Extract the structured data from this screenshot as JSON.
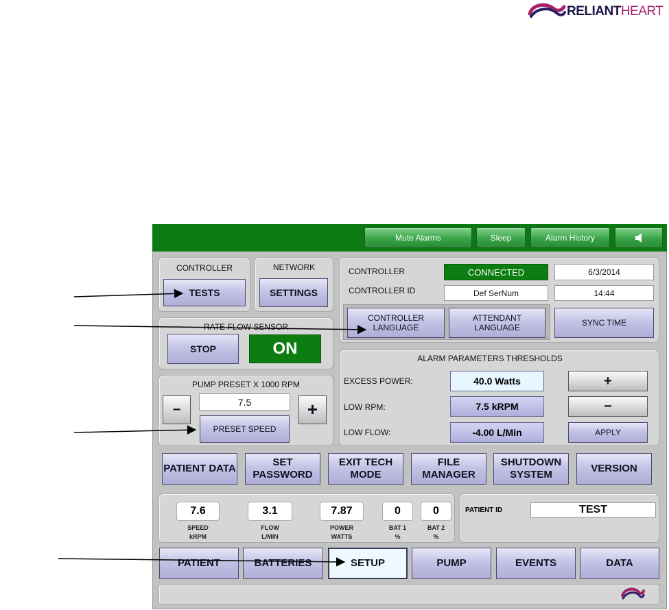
{
  "logo": {
    "part1": "RELIANT",
    "part2": "HEART"
  },
  "topbar": {
    "mute_alarms": "Mute Alarms",
    "sleep": "Sleep",
    "alarm_history": "Alarm History",
    "speaker_icon": "speaker-icon"
  },
  "controller_tests": {
    "title": "CONTROLLER",
    "button": "TESTS"
  },
  "network_settings": {
    "title": "NETWORK",
    "button": "SETTINGS"
  },
  "status": {
    "controller_label": "CONTROLLER",
    "controller_status": "CONNECTED",
    "date": "6/3/2014",
    "controller_id_label": "CONTROLLER ID",
    "controller_id": "Def SerNum",
    "time": "14:44",
    "controller_language": "CONTROLLER LANGUAGE",
    "attendant_language": "ATTENDANT LANGUAGE",
    "sync_time": "SYNC TIME",
    "status_color": "#0b7d11"
  },
  "rate_flow_sensor": {
    "title": "RATE FLOW SENSOR",
    "stop": "STOP",
    "state": "ON"
  },
  "pump_preset": {
    "title": "PUMP PRESET X 1000 RPM",
    "value": "7.5",
    "minus": "−",
    "plus": "+",
    "preset_speed": "PRESET SPEED"
  },
  "alarm_thresholds": {
    "title": "ALARM PARAMETERS THRESHOLDS",
    "excess_power_label": "EXCESS POWER:",
    "excess_power_value": "40.0 Watts",
    "low_rpm_label": "LOW RPM:",
    "low_rpm_value": "7.5 kRPM",
    "low_flow_label": "LOW FLOW:",
    "low_flow_value": "-4.00 L/Min",
    "plus": "+",
    "minus": "−",
    "apply": "APPLY"
  },
  "actions": [
    {
      "label": "PATIENT DATA"
    },
    {
      "label": "SET PASSWORD"
    },
    {
      "label": "EXIT TECH MODE"
    },
    {
      "label": "FILE MANAGER"
    },
    {
      "label": "SHUTDOWN SYSTEM"
    },
    {
      "label": "VERSION"
    }
  ],
  "metrics": [
    {
      "value": "7.6",
      "label1": "SPEED",
      "label2": "kRPM"
    },
    {
      "value": "3.1",
      "label1": "FLOW",
      "label2": "L/MIN"
    },
    {
      "value": "7.87",
      "label1": "POWER",
      "label2": "WATTS"
    },
    {
      "value": "0",
      "label1": "BAT 1",
      "label2": "%"
    },
    {
      "value": "0",
      "label1": "BAT 2",
      "label2": "%"
    }
  ],
  "patient": {
    "label": "PATIENT ID",
    "value": "TEST"
  },
  "tabs": [
    {
      "label": "PATIENT"
    },
    {
      "label": "BATTERIES"
    },
    {
      "label": "SETUP",
      "active": true
    },
    {
      "label": "PUMP"
    },
    {
      "label": "EVENTS"
    },
    {
      "label": "DATA"
    }
  ],
  "colors": {
    "topbar": "#0c7a12",
    "accent_button": "#aeaed8",
    "brand_purple": "#a3216b"
  }
}
